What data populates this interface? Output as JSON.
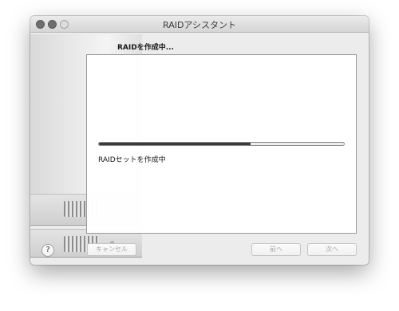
{
  "window": {
    "title": "RAIDアシスタント"
  },
  "content": {
    "heading": "RAIDを作成中...",
    "status_text": "RAIDセットを作成中",
    "progress": 0.62
  },
  "buttons": {
    "help_label": "?",
    "cancel_label": "キャンセル",
    "prev_label": "前へ",
    "next_label": "次へ"
  },
  "colors": {
    "progress_fill": "#3a3a3a",
    "disabled_text": "#a6a6a6"
  }
}
